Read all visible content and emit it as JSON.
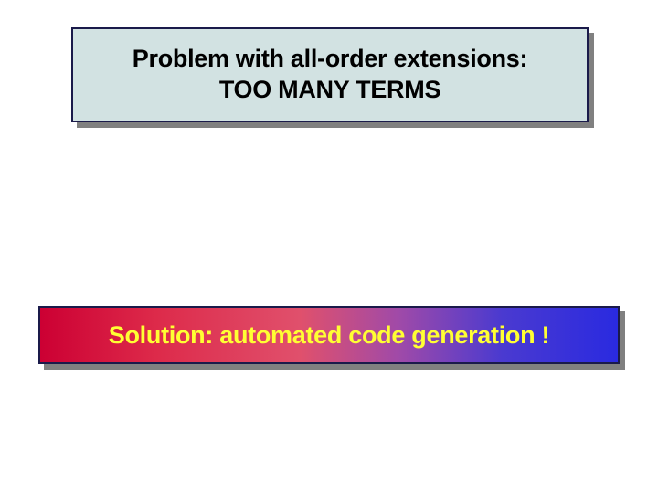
{
  "top": {
    "line1": "Problem with all-order extensions:",
    "line2": "TOO MANY TERMS"
  },
  "bottom": {
    "text": "Solution: automated code generation !"
  }
}
